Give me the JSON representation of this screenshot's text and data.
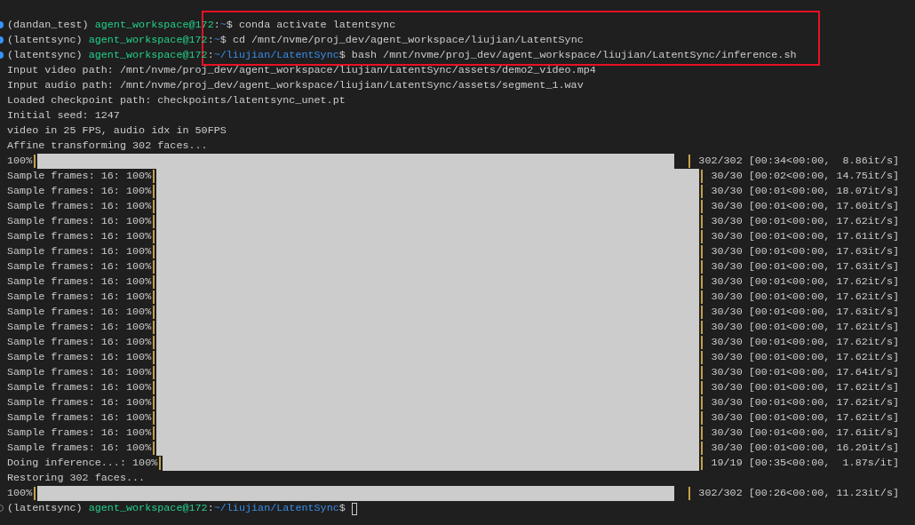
{
  "highlight": {
    "kind": "rectangle"
  },
  "lines": [
    {
      "kind": "prompt",
      "succeeded": true,
      "env": "(dandan_test)",
      "user": "agent_workspace@172",
      "colon": ":",
      "path": "~",
      "dollar": "$",
      "command": "conda activate latentsync"
    },
    {
      "kind": "prompt",
      "succeeded": true,
      "env": "(latentsync)",
      "user": "agent_workspace@172",
      "colon": ":",
      "path": "~",
      "dollar": "$",
      "command": "cd /mnt/nvme/proj_dev/agent_workspace/liujian/LatentSync"
    },
    {
      "kind": "prompt",
      "succeeded": true,
      "env": "(latentsync)",
      "user": "agent_workspace@172",
      "colon": ":",
      "path": "~/liujian/LatentSync",
      "dollar": "$",
      "command": "bash /mnt/nvme/proj_dev/agent_workspace/liujian/LatentSync/inference.sh"
    },
    {
      "kind": "output",
      "text": "Input video path: /mnt/nvme/proj_dev/agent_workspace/liujian/LatentSync/assets/demo2_video.mp4"
    },
    {
      "kind": "output",
      "text": "Input audio path: /mnt/nvme/proj_dev/agent_workspace/liujian/LatentSync/assets/segment_1.wav"
    },
    {
      "kind": "output",
      "text": "Loaded checkpoint path: checkpoints/latentsync_unet.pt"
    },
    {
      "kind": "output",
      "text": "Initial seed: 1247"
    },
    {
      "kind": "output",
      "text": "video in 25 FPS, audio idx in 50FPS"
    },
    {
      "kind": "output",
      "text": "Affine transforming 302 faces..."
    },
    {
      "kind": "progress",
      "label": "100%",
      "level": 1,
      "stats": "302/302 [00:34<00:00,  8.86it/s]"
    },
    {
      "kind": "progress",
      "label": "Sample frames: 16: 100%",
      "level": 1,
      "stats": "30/30 [00:02<00:00, 14.75it/s]"
    },
    {
      "kind": "progress",
      "label": "Sample frames: 16: 100%",
      "level": 1,
      "stats": "30/30 [00:01<00:00, 18.07it/s]"
    },
    {
      "kind": "progress",
      "label": "Sample frames: 16: 100%",
      "level": 1,
      "stats": "30/30 [00:01<00:00, 17.60it/s]"
    },
    {
      "kind": "progress",
      "label": "Sample frames: 16: 100%",
      "level": 1,
      "stats": "30/30 [00:01<00:00, 17.62it/s]"
    },
    {
      "kind": "progress",
      "label": "Sample frames: 16: 100%",
      "level": 1,
      "stats": "30/30 [00:01<00:00, 17.61it/s]"
    },
    {
      "kind": "progress",
      "label": "Sample frames: 16: 100%",
      "level": 1,
      "stats": "30/30 [00:01<00:00, 17.63it/s]"
    },
    {
      "kind": "progress",
      "label": "Sample frames: 16: 100%",
      "level": 1,
      "stats": "30/30 [00:01<00:00, 17.63it/s]"
    },
    {
      "kind": "progress",
      "label": "Sample frames: 16: 100%",
      "level": 1,
      "stats": "30/30 [00:01<00:00, 17.62it/s]"
    },
    {
      "kind": "progress",
      "label": "Sample frames: 16: 100%",
      "level": 1,
      "stats": "30/30 [00:01<00:00, 17.62it/s]"
    },
    {
      "kind": "progress",
      "label": "Sample frames: 16: 100%",
      "level": 1,
      "stats": "30/30 [00:01<00:00, 17.63it/s]"
    },
    {
      "kind": "progress",
      "label": "Sample frames: 16: 100%",
      "level": 1,
      "stats": "30/30 [00:01<00:00, 17.62it/s]"
    },
    {
      "kind": "progress",
      "label": "Sample frames: 16: 100%",
      "level": 1,
      "stats": "30/30 [00:01<00:00, 17.62it/s]"
    },
    {
      "kind": "progress",
      "label": "Sample frames: 16: 100%",
      "level": 1,
      "stats": "30/30 [00:01<00:00, 17.62it/s]"
    },
    {
      "kind": "progress",
      "label": "Sample frames: 16: 100%",
      "level": 1,
      "stats": "30/30 [00:01<00:00, 17.64it/s]"
    },
    {
      "kind": "progress",
      "label": "Sample frames: 16: 100%",
      "level": 1,
      "stats": "30/30 [00:01<00:00, 17.62it/s]"
    },
    {
      "kind": "progress",
      "label": "Sample frames: 16: 100%",
      "level": 1,
      "stats": "30/30 [00:01<00:00, 17.62it/s]"
    },
    {
      "kind": "progress",
      "label": "Sample frames: 16: 100%",
      "level": 1,
      "stats": "30/30 [00:01<00:00, 17.62it/s]"
    },
    {
      "kind": "progress",
      "label": "Sample frames: 16: 100%",
      "level": 1,
      "stats": "30/30 [00:01<00:00, 17.61it/s]"
    },
    {
      "kind": "progress",
      "label": "Sample frames: 16: 100%",
      "level": 1,
      "stats": "30/30 [00:01<00:00, 16.29it/s]"
    },
    {
      "kind": "progress",
      "label": "Doing inference...: 100%",
      "level": 1,
      "stats": "19/19 [00:35<00:00,  1.87s/it]"
    },
    {
      "kind": "output",
      "text": "Restoring 302 faces..."
    },
    {
      "kind": "progress",
      "label": "100%",
      "level": 1,
      "stats": "302/302 [00:26<00:00, 11.23it/s]"
    },
    {
      "kind": "prompt",
      "succeeded": false,
      "env": "(latentsync)",
      "user": "agent_workspace@172",
      "colon": ":",
      "path": "~/liujian/LatentSync",
      "dollar": "$",
      "cursor": true
    }
  ]
}
